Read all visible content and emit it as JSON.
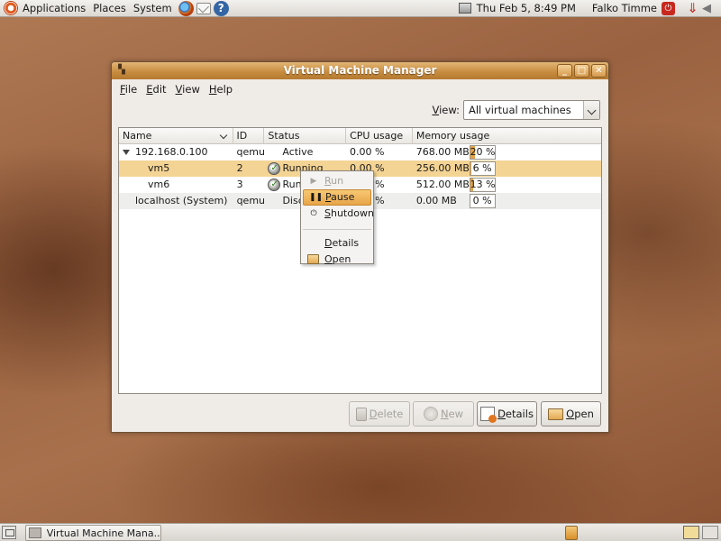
{
  "top_panel": {
    "menus": [
      "Applications",
      "Places",
      "System"
    ],
    "clock": "Thu Feb  5,  8:49 PM",
    "user": "Falko Timme"
  },
  "bottom_panel": {
    "task_label": "Virtual Machine Mana..."
  },
  "window": {
    "title": "Virtual Machine Manager",
    "menubar": [
      "File",
      "Edit",
      "View",
      "Help"
    ],
    "view_label": "View:",
    "view_value": "All virtual machines",
    "columns": [
      "Name",
      "ID",
      "Status",
      "CPU usage",
      "Memory usage"
    ],
    "rows": [
      {
        "name": "192.168.0.100",
        "id": "qemu",
        "status": "Active",
        "cpu": "0.00 %",
        "mem": "768.00 MB",
        "pct": "20 %",
        "fill": 0.2
      },
      {
        "name": "vm5",
        "id": "2",
        "status": "Running",
        "cpu": "0.00 %",
        "mem": "256.00 MB",
        "pct": "6 %",
        "fill": 0.06
      },
      {
        "name": "vm6",
        "id": "3",
        "status": "Running",
        "cpu": "0.00 %",
        "mem": "512.00 MB",
        "pct": "13 %",
        "fill": 0.13
      },
      {
        "name": "localhost (System)",
        "id": "qemu",
        "status": "Disconnected",
        "cpu": "0.00 %",
        "mem": "0.00 MB",
        "pct": "0 %",
        "fill": 0
      }
    ],
    "context_menu": [
      "Run",
      "Pause",
      "Shutdown",
      "Details",
      "Open"
    ],
    "buttons": [
      "Delete",
      "New",
      "Details",
      "Open"
    ]
  },
  "colors": {
    "selection": "#f4d494",
    "titlebar": "#c58a3e",
    "bar_fill": "#e3a24a"
  }
}
